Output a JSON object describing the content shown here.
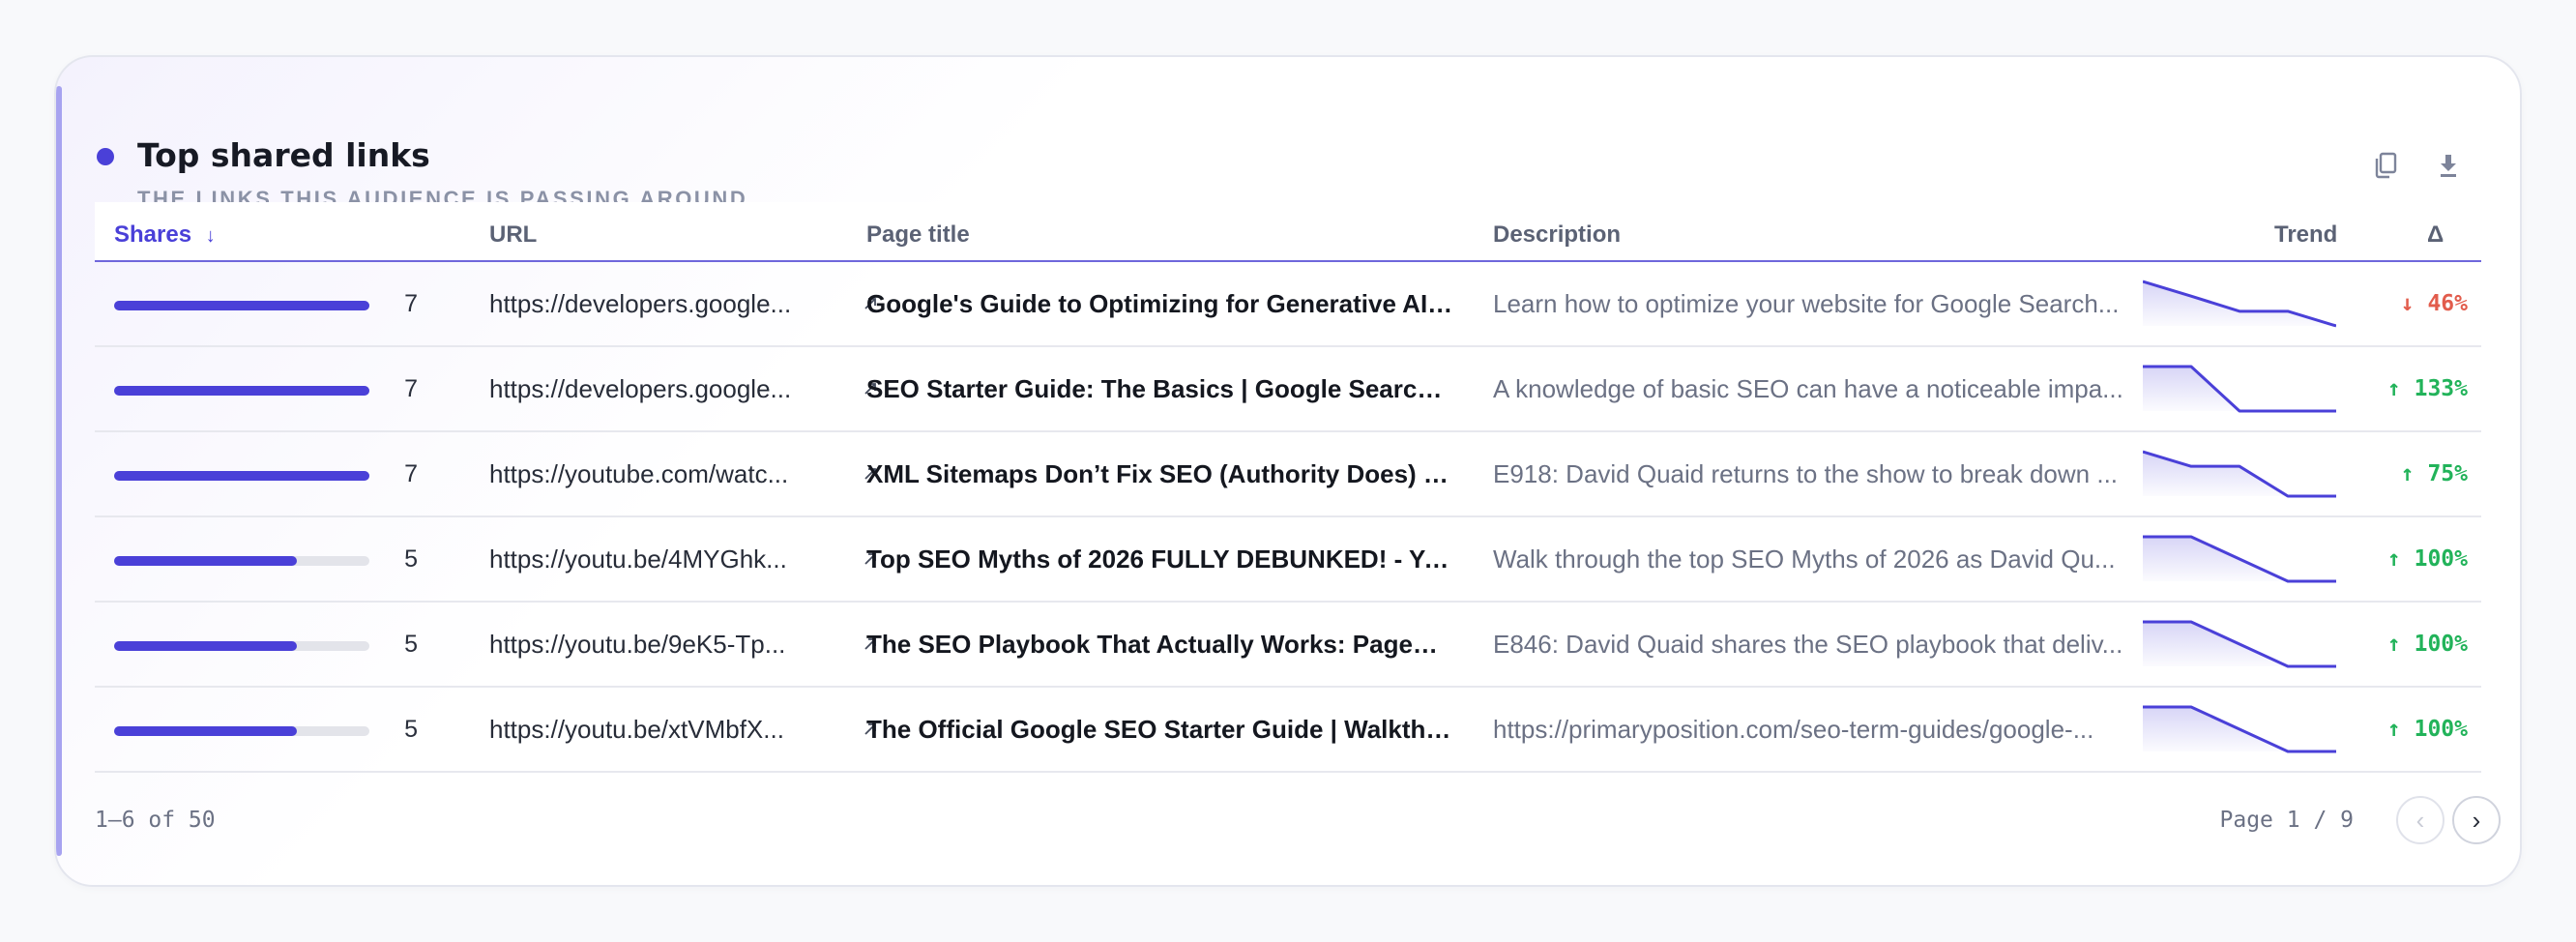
{
  "header": {
    "title": "Top shared links",
    "subtitle": "THE LINKS THIS AUDIENCE IS PASSING AROUND"
  },
  "table": {
    "columns": {
      "shares": "Shares",
      "sort_glyph": "↓",
      "url": "URL",
      "page_title": "Page title",
      "description": "Description",
      "trend": "Trend",
      "delta": "Δ"
    },
    "max_shares": 7,
    "rows": [
      {
        "shares": 7,
        "shares_text": "7",
        "url": "https://developers.google...",
        "page_title": "Google's Guide to Optimizing for Generative AI F...",
        "description": "Learn how to optimize your website for Google Search...",
        "trend": [
          1.0,
          0.67,
          0.33,
          0.33,
          0.0
        ],
        "delta_text": "↓ 46%",
        "delta_dir": "down"
      },
      {
        "shares": 7,
        "shares_text": "7",
        "url": "https://developers.google...",
        "page_title": "SEO Starter Guide: The Basics | Google Search C...",
        "description": "A knowledge of basic SEO can have a noticeable impa...",
        "trend": [
          1.0,
          1.0,
          0.0,
          0.0,
          0.0
        ],
        "delta_text": "↑ 133%",
        "delta_dir": "up"
      },
      {
        "shares": 7,
        "shares_text": "7",
        "url": "https://youtube.com/watc...",
        "page_title": "XML Sitemaps Don’t Fix SEO (Authority Does) - Y...",
        "description": "E918: David Quaid returns to the show to break down ...",
        "trend": [
          1.0,
          0.67,
          0.67,
          0.0,
          0.0
        ],
        "delta_text": "↑ 75%",
        "delta_dir": "up"
      },
      {
        "shares": 5,
        "shares_text": "5",
        "url": "https://youtu.be/4MYGhk...",
        "page_title": "Top SEO Myths of 2026 FULLY DEBUNKED! - You...",
        "description": "Walk through the top SEO Myths of 2026 as David Qu...",
        "trend": [
          1.0,
          1.0,
          0.5,
          0.0,
          0.0
        ],
        "delta_text": "↑ 100%",
        "delta_dir": "up"
      },
      {
        "shares": 5,
        "shares_text": "5",
        "url": "https://youtu.be/9eK5-Tp...",
        "page_title": "The SEO Playbook That Actually Works: PageRa...",
        "description": "E846: David Quaid shares the SEO playbook that deliv...",
        "trend": [
          1.0,
          1.0,
          0.5,
          0.0,
          0.0
        ],
        "delta_text": "↑ 100%",
        "delta_dir": "up"
      },
      {
        "shares": 5,
        "shares_text": "5",
        "url": "https://youtu.be/xtVMbfX...",
        "page_title": "The Official Google SEO Starter Guide | Walkthro...",
        "description": "https://primaryposition.com/seo-term-guides/google-...",
        "trend": [
          1.0,
          1.0,
          0.5,
          0.0,
          0.0
        ],
        "delta_text": "↑ 100%",
        "delta_dir": "up"
      }
    ]
  },
  "footer": {
    "range": "1–6 of 50",
    "page": "Page 1 / 9",
    "prev": "‹",
    "next": "›"
  },
  "colors": {
    "accent": "#4a40d8",
    "up": "#22b35a",
    "down": "#e25c4c"
  },
  "icons": {
    "copy": "copy-icon",
    "download": "download-icon",
    "external": "external-link-icon"
  }
}
